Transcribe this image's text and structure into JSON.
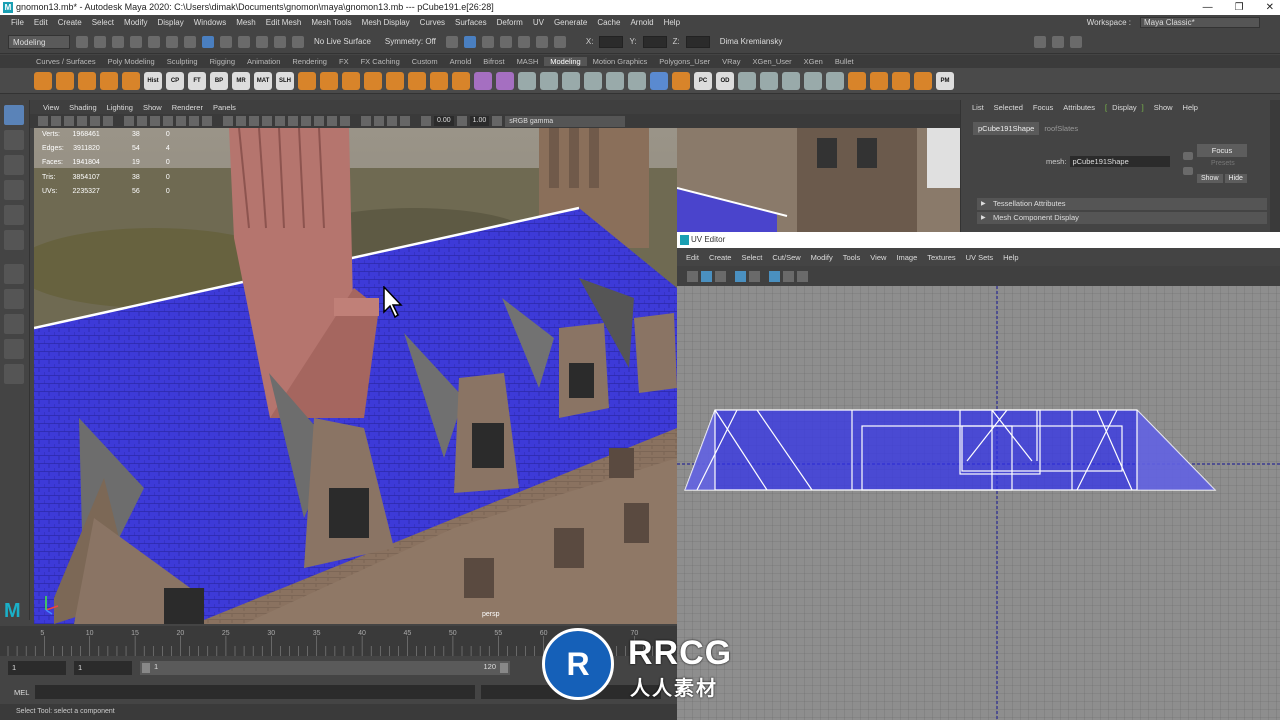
{
  "window": {
    "title": "gnomon13.mb* - Autodesk Maya 2020: C:\\Users\\dimak\\Documents\\gnomon\\maya\\gnomon13.mb --- pCube191.e[26:28]",
    "controls": [
      "—",
      "❐",
      "✕"
    ]
  },
  "menubar": {
    "items": [
      "File",
      "Edit",
      "Create",
      "Select",
      "Modify",
      "Display",
      "Windows",
      "Mesh",
      "Edit Mesh",
      "Mesh Tools",
      "Mesh Display",
      "Curves",
      "Surfaces",
      "Deform",
      "UV",
      "Generate",
      "Cache",
      "Arnold",
      "Help"
    ],
    "workspace_label": "Workspace :",
    "workspace_value": "Maya Classic*"
  },
  "statusline": {
    "menuset": "Modeling",
    "live_surface": "No Live Surface",
    "symmetry": "Symmetry: Off",
    "x_label": "X:",
    "y_label": "Y:",
    "z_label": "Z:",
    "user": "Dima Kremiansky"
  },
  "shelf": {
    "tabs": [
      "Curves / Surfaces",
      "Poly Modeling",
      "Sculpting",
      "Rigging",
      "Animation",
      "Rendering",
      "FX",
      "FX Caching",
      "Custom",
      "Arnold",
      "Bifrost",
      "MASH",
      "Modeling",
      "Motion Graphics",
      "Polygons_User",
      "VRay",
      "XGen_User",
      "XGen",
      "Bullet"
    ],
    "active_tab": "Modeling",
    "buttons": [
      "Hist",
      "CP",
      "FT",
      "BP",
      "MR",
      "MAT",
      "SLH",
      "PC",
      "OD",
      "PM"
    ]
  },
  "viewport": {
    "menu": [
      "View",
      "Shading",
      "Lighting",
      "Show",
      "Renderer",
      "Panels"
    ],
    "gamma_value": "0.00",
    "exposure_value": "1.00",
    "colorspace": "sRGB gamma",
    "camera_label": "persp",
    "hud": [
      {
        "label": "Verts:",
        "total": "1968461",
        "selected": "38",
        "comp": "0"
      },
      {
        "label": "Edges:",
        "total": "3911820",
        "selected": "54",
        "comp": "4"
      },
      {
        "label": "Faces:",
        "total": "1941804",
        "selected": "19",
        "comp": "0"
      },
      {
        "label": "Tris:",
        "total": "3854107",
        "selected": "38",
        "comp": "0"
      },
      {
        "label": "UVs:",
        "total": "2235327",
        "selected": "56",
        "comp": "0"
      }
    ]
  },
  "attribute_editor": {
    "menu": [
      "List",
      "Selected",
      "Focus",
      "Attributes",
      "Display",
      "Show",
      "Help"
    ],
    "active_menu": "Display",
    "tabs": [
      "pCube191Shape",
      "roofSlates"
    ],
    "mesh_label": "mesh:",
    "mesh_value": "pCube191Shape",
    "focus_button": "Focus",
    "presets_label": "Presets",
    "show_button": "Show",
    "hide_button": "Hide",
    "sections": [
      "Tessellation Attributes",
      "Mesh Component Display"
    ]
  },
  "uv_editor": {
    "title": "UV Editor",
    "menu": [
      "Edit",
      "Create",
      "Select",
      "Cut/Sew",
      "Modify",
      "Tools",
      "View",
      "Image",
      "Textures",
      "UV Sets",
      "Help"
    ]
  },
  "timeline": {
    "ticks": [
      "5",
      "10",
      "15",
      "20",
      "25",
      "30",
      "35",
      "40",
      "45",
      "50",
      "55",
      "60",
      "65",
      "70"
    ],
    "range_start": "1",
    "range_start2": "1",
    "range_inner_start": "1",
    "range_inner_end": "120"
  },
  "command_line": {
    "label": "MEL",
    "help_text": "Select Tool: select a component"
  },
  "watermark": {
    "logo_text": "R",
    "brand": "RRCG",
    "sub": "人人素材"
  },
  "colors": {
    "accent_blue": "#3a3ae0",
    "maya_teal": "#1a9fb3",
    "display_green": "#7cc04a"
  }
}
